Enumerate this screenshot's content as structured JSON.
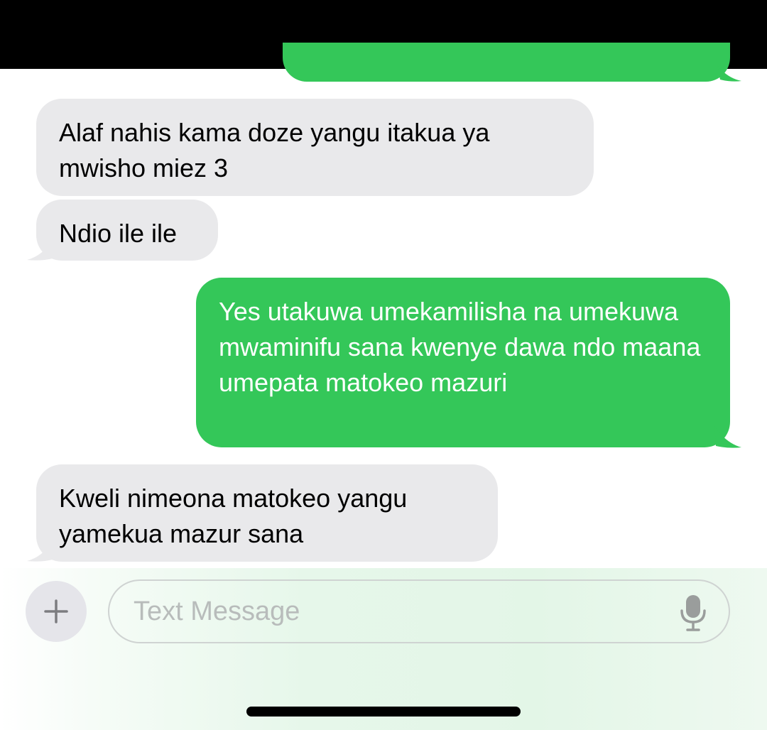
{
  "conversation": {
    "messages": [
      {
        "direction": "incoming",
        "text": "Alaf nahis kama doze yangu itakua ya mwisho miez 3"
      },
      {
        "direction": "incoming",
        "text": "Ndio ile ile"
      },
      {
        "direction": "outgoing",
        "text": "Yes utakuwa umekamilisha na umekuwa mwaminifu sana kwenye dawa ndo maana umepata matokeo mazuri"
      },
      {
        "direction": "incoming",
        "text": "Kweli nimeona matokeo yangu yamekua mazur sana"
      }
    ]
  },
  "composer": {
    "placeholder": "Text Message",
    "add_icon": "plus-icon",
    "mic_icon": "microphone-icon"
  },
  "colors": {
    "incoming_bubble": "#e9e9eb",
    "outgoing_bubble": "#34c759",
    "status_bar": "#000000"
  }
}
